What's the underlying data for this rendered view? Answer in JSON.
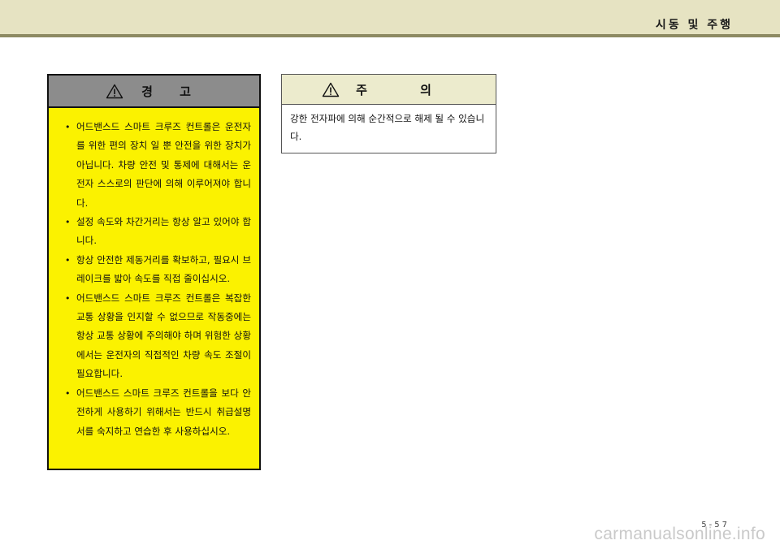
{
  "header": {
    "section_title": "시동 및 주행"
  },
  "warning": {
    "icon": "warning-triangle-icon",
    "title": "경 고",
    "items": [
      "어드밴스드 스마트 크루즈 컨트롤은 운전자를 위한 편의 장치 일 뿐 안전을 위한 장치가 아닙니다. 차량 안전 및 통제에 대해서는 운전자 스스로의 판단에 의해 이루어져야 합니다.",
      "설정 속도와 차간거리는 항상 알고 있어야 합니다.",
      "항상 안전한 제동거리를 확보하고, 필요시 브레이크를 밟아 속도를 직접 줄이십시오.",
      "어드밴스드 스마트 크루즈 컨트롤은 복잡한 교통 상황을 인지할 수 없으므로 작동중에는 항상 교통 상황에 주의해야 하며 위험한 상황에서는 운전자의 직접적인 차량 속도 조절이 필요합니다.",
      "어드밴스드 스마트 크루즈 컨트롤을 보다 안전하게 사용하기 위해서는 반드시 취급설명서를 숙지하고 연습한 후 사용하십시오."
    ],
    "background_color": "#fbf200",
    "header_color": "#8c8c8c"
  },
  "caution": {
    "icon": "warning-triangle-icon",
    "title": "주 의",
    "text": "강한 전자파에 의해 순간적으로 해제 될 수 있습니다.",
    "header_color": "#ecebcd"
  },
  "footer": {
    "page_number": "5-57"
  },
  "watermark": "carmanualsonline.info"
}
